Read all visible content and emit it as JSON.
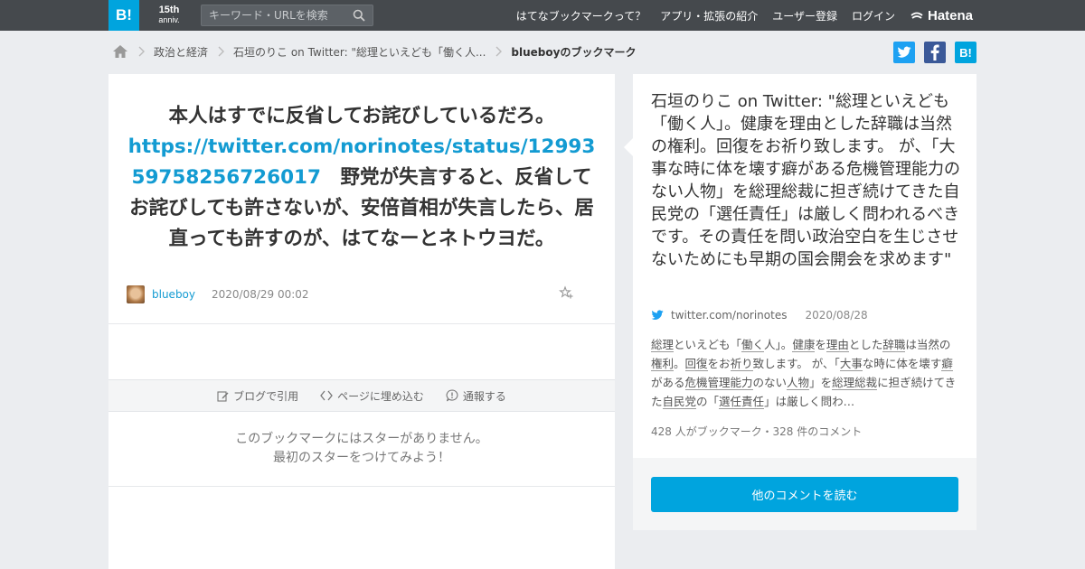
{
  "topbar": {
    "logo": "B!",
    "anniv_main": "15th",
    "anniv_sub": "anniv.",
    "search_placeholder": "キーワード・URLを検索",
    "nav": [
      "はてなブックマークって？",
      "アプリ・拡張の紹介",
      "ユーザー登録",
      "ログイン"
    ],
    "brand": "Hatena"
  },
  "breadcrumb": {
    "items": [
      "政治と経済",
      "石垣のりこ on Twitter: \"総理といえども「働く人..."
    ],
    "current": "blueboyのブックマーク"
  },
  "share": {
    "hatena_label": "B!"
  },
  "bookmark": {
    "comment_before": "本人はすでに反省してお詫びしているだろ。",
    "link": "https://twitter.com/norinotes/status/1299359758256726017",
    "comment_after": "野党が失言すると、反省してお詫びしても許さないが、安倍首相が失言したら、居直っても許すのが、はてなーとネトウヨだ。",
    "user": "blueboy",
    "date": "2020/08/29 00:02"
  },
  "toolbar": {
    "blog": "ブログで引用",
    "embed": "ページに埋め込む",
    "report": "通報する"
  },
  "stars": {
    "line1": "このブックマークにはスターがありません。",
    "line2": "最初のスターをつけてみよう！"
  },
  "entry": {
    "title": "石垣のりこ on Twitter: \"総理といえども「働く人」。健康を理由とした辞職は当然の権利。回復をお祈り致します。 が、「大事な時に体を壊す癖がある危機管理能力のない人物」を総理総裁に担ぎ続けてきた自民党の「選任責任」は厳しく問われるべきです。その責任を問い政治空白を生じさせないためにも早期の国会開会を求めます\"",
    "source": "twitter.com/norinotes",
    "date": "2020/08/28",
    "excerpt": [
      "総理",
      "といえども「",
      "働く",
      "人」。",
      "健康",
      "を",
      "理由",
      "とした",
      "辞職",
      "は当然の",
      "権利",
      "。",
      "回復",
      "をお",
      "祈り",
      "致します。 が、「",
      "大事",
      "な時に体を壊す",
      "癖",
      "がある",
      "危機管理能力",
      "のない",
      "人物",
      "」を",
      "総理総裁",
      "に担ぎ続けてきた",
      "自民党",
      "の「",
      "選任責任",
      "」は厳しく問わ…"
    ],
    "counts": "428 人がブックマーク・328 件のコメント",
    "read_more": "他のコメントを読む"
  },
  "colors": {
    "topbar": "#45494d",
    "brand_blue": "#00a4de",
    "link": "#139bd2",
    "twitter": "#1da1f2",
    "facebook": "#3b5998"
  }
}
